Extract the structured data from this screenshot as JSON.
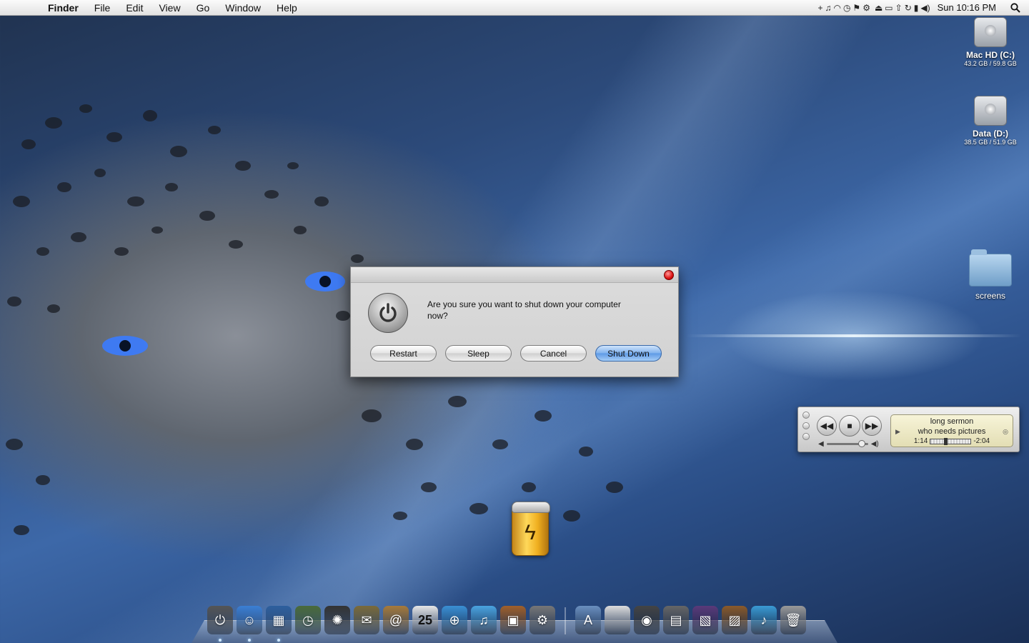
{
  "menubar": {
    "app_name": "Finder",
    "menus": [
      "File",
      "Edit",
      "View",
      "Go",
      "Window",
      "Help"
    ],
    "clock": "Sun 10:16 PM",
    "status_icons": [
      "plus-icon",
      "music-note-icon",
      "wifi-icon",
      "clock-icon",
      "flag-icon",
      "gears-icon",
      "apple-icon",
      "eject-icon",
      "display-icon",
      "airplay-icon",
      "battery-icon",
      "volume-icon",
      "time-machine-icon"
    ]
  },
  "desktop": {
    "icons": [
      {
        "label": "Mac HD (C:)",
        "sub": "43.2 GB / 59.8 GB",
        "icon": "hard-drive-icon"
      },
      {
        "label": "Data (D:)",
        "sub": "38.5 GB / 51.9 GB",
        "icon": "hard-drive-icon"
      },
      {
        "label": "screens",
        "sub": "",
        "icon": "folder-icon"
      }
    ]
  },
  "dialog": {
    "message": "Are you sure you want to shut down your computer now?",
    "buttons": {
      "restart": "Restart",
      "sleep": "Sleep",
      "cancel": "Cancel",
      "shutdown": "Shut Down"
    }
  },
  "player": {
    "line1": "long sermon",
    "line2": "who needs pictures",
    "elapsed": "1:14",
    "remaining": "-2:04",
    "progress": 0.36,
    "volume": 0.85
  },
  "dock": {
    "items": [
      {
        "name": "power",
        "glyph": "⏻",
        "running": true
      },
      {
        "name": "finder",
        "glyph": "☺",
        "running": true
      },
      {
        "name": "dashboard",
        "glyph": "▦",
        "running": true
      },
      {
        "name": "time-machine",
        "glyph": "◷",
        "running": false
      },
      {
        "name": "dashboard-widgets",
        "glyph": "✺",
        "running": false
      },
      {
        "name": "mail",
        "glyph": "✉",
        "running": false
      },
      {
        "name": "address-book",
        "glyph": "@",
        "running": false
      },
      {
        "name": "ical",
        "glyph": "25",
        "running": false
      },
      {
        "name": "safari",
        "glyph": "⊕",
        "running": false
      },
      {
        "name": "itunes",
        "glyph": "♫",
        "running": false
      },
      {
        "name": "iphoto",
        "glyph": "▣",
        "running": false
      },
      {
        "name": "system-preferences",
        "glyph": "⚙",
        "running": false
      },
      {
        "name": "applications",
        "glyph": "A",
        "running": false
      },
      {
        "name": "preview",
        "glyph": "",
        "running": false
      },
      {
        "name": "camera",
        "glyph": "◉",
        "running": false
      },
      {
        "name": "documents",
        "glyph": "▤",
        "running": false
      },
      {
        "name": "photos",
        "glyph": "▧",
        "running": false
      },
      {
        "name": "pictures",
        "glyph": "▨",
        "running": false
      },
      {
        "name": "itunes-alt",
        "glyph": "♪",
        "running": false
      },
      {
        "name": "trash",
        "glyph": "🗑",
        "running": false
      }
    ]
  },
  "colors": {
    "accent": "#5d99e6",
    "wallpaper": "#2c4a7a",
    "close_red": "#d11111"
  }
}
